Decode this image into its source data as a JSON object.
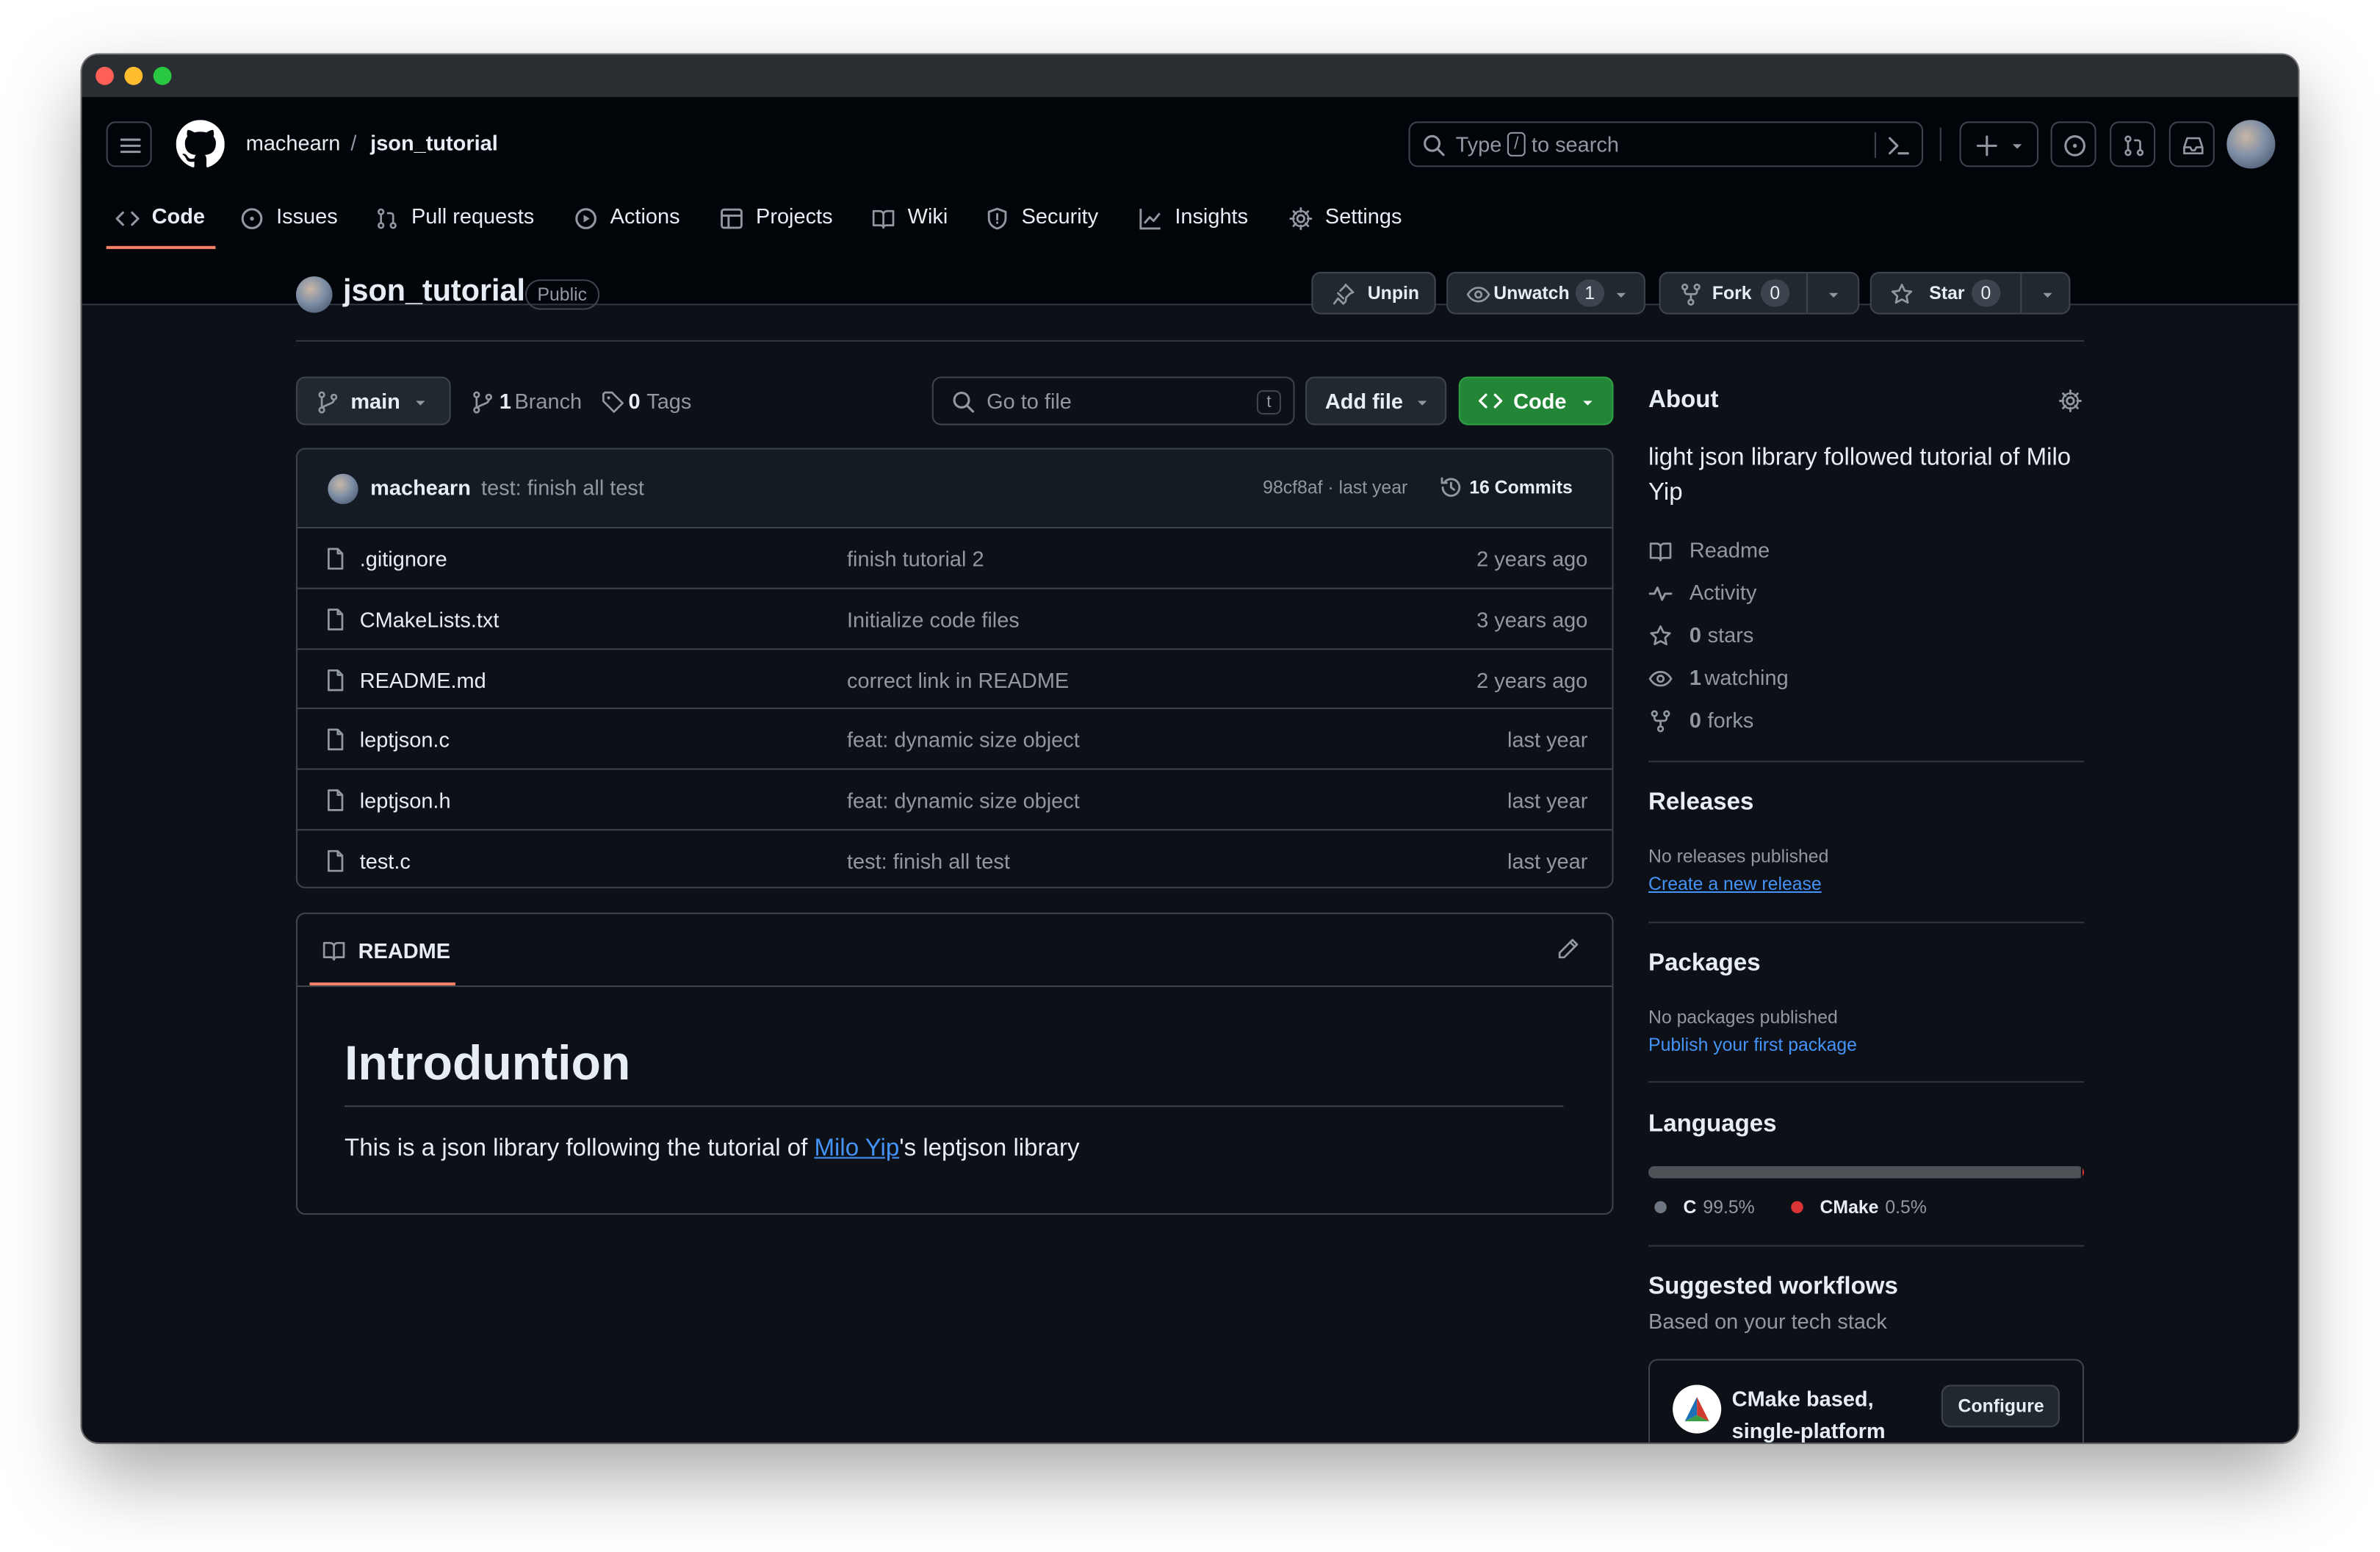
{
  "header": {
    "owner": "machearn",
    "slash": "/",
    "repo": "json_tutorial",
    "search_prefix": "Type",
    "search_key": "/",
    "search_suffix": "to search"
  },
  "nav": {
    "tabs": [
      {
        "label": "Code",
        "icon": "code-icon",
        "active": true
      },
      {
        "label": "Issues",
        "icon": "issue-icon"
      },
      {
        "label": "Pull requests",
        "icon": "pull-request-icon"
      },
      {
        "label": "Actions",
        "icon": "play-icon"
      },
      {
        "label": "Projects",
        "icon": "table-icon"
      },
      {
        "label": "Wiki",
        "icon": "book-icon"
      },
      {
        "label": "Security",
        "icon": "shield-icon"
      },
      {
        "label": "Insights",
        "icon": "graph-icon"
      },
      {
        "label": "Settings",
        "icon": "gear-icon"
      }
    ]
  },
  "repo_head": {
    "name": "json_tutorial",
    "visibility": "Public",
    "unpin": "Unpin",
    "unwatch": "Unwatch",
    "watch_count": "1",
    "fork": "Fork",
    "fork_count": "0",
    "star": "Star",
    "star_count": "0"
  },
  "toolbar": {
    "branch": "main",
    "branch_count": "1",
    "branch_label": "Branch",
    "tag_count": "0",
    "tag_label": "Tags",
    "go_to_file": "Go to file",
    "go_to_file_key": "t",
    "add_file": "Add file",
    "code": "Code"
  },
  "commit": {
    "author": "machearn",
    "message": "test: finish all test",
    "hash_time": "98cf8af · last year",
    "commits": "16 Commits"
  },
  "files": [
    {
      "name": ".gitignore",
      "message": "finish tutorial 2",
      "time": "2 years ago"
    },
    {
      "name": "CMakeLists.txt",
      "message": "Initialize code files",
      "time": "3 years ago"
    },
    {
      "name": "README.md",
      "message": "correct link in README",
      "time": "2 years ago"
    },
    {
      "name": "leptjson.c",
      "message": "feat: dynamic size object",
      "time": "last year"
    },
    {
      "name": "leptjson.h",
      "message": "feat: dynamic size object",
      "time": "last year"
    },
    {
      "name": "test.c",
      "message": "test: finish all test",
      "time": "last year"
    }
  ],
  "readme": {
    "tab": "README",
    "heading": "Introduntion",
    "text_before": "This is a json library following the tutorial of ",
    "link": "Milo Yip",
    "text_after": "'s leptjson library"
  },
  "about": {
    "title": "About",
    "description_line1": "light json library followed tutorial of Milo",
    "description_line2": "Yip",
    "readme": "Readme",
    "activity": "Activity",
    "stars_count": "0",
    "stars_label": "stars",
    "watching_count": "1",
    "watching_label": "watching",
    "forks_count": "0",
    "forks_label": "forks"
  },
  "releases": {
    "title": "Releases",
    "empty": "No releases published",
    "link": "Create a new release"
  },
  "packages": {
    "title": "Packages",
    "empty": "No packages published",
    "link": "Publish your first package"
  },
  "languages": {
    "title": "Languages",
    "items": [
      {
        "name": "C",
        "percent": "99.5%",
        "value": 99.5,
        "color": "#555555"
      },
      {
        "name": "CMake",
        "percent": "0.5%",
        "value": 0.5,
        "color": "#DA3434"
      }
    ]
  },
  "workflows": {
    "title": "Suggested workflows",
    "subtitle": "Based on your tech stack",
    "card_title_line1": "CMake based,",
    "card_title_line2": "single-platform",
    "configure": "Configure"
  },
  "colors": {
    "accent_orange": "#f78166",
    "green_button": "#238636",
    "link_blue": "#4493f8"
  }
}
